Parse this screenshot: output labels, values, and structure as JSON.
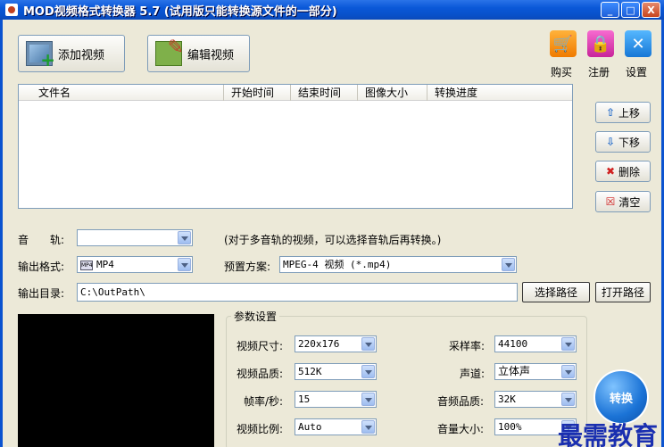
{
  "window": {
    "title": "MOD视频格式转换器 5.7 (试用版只能转换源文件的一部分)",
    "controls": {
      "minimize": "_",
      "maximize": "□",
      "close": "X"
    }
  },
  "toolbar": {
    "add_video": "添加视频",
    "edit_video": "编辑视频",
    "buy": "购买",
    "register": "注册",
    "settings": "设置"
  },
  "filelist": {
    "columns": [
      "文件名",
      "开始时间",
      "结束时间",
      "图像大小",
      "转换进度"
    ],
    "rows": []
  },
  "side_buttons": {
    "move_up": "上移",
    "move_down": "下移",
    "delete": "删除",
    "clear": "清空"
  },
  "audio_track": {
    "label": "音　　轨:",
    "value": "",
    "hint": "(对于多音轨的视频，可以选择音轨后再转换。)"
  },
  "output_format": {
    "label": "输出格式:",
    "badge": "MP4",
    "value": "MP4"
  },
  "preset": {
    "label": "预置方案:",
    "value": "MPEG-4 视频 (*.mp4)"
  },
  "output_dir": {
    "label": "输出目录:",
    "value": "C:\\OutPath\\",
    "choose_button": "选择路径",
    "open_button": "打开路径"
  },
  "params": {
    "title": "参数设置",
    "video_size_label": "视频尺寸:",
    "video_size": "220x176",
    "video_quality_label": "视频品质:",
    "video_quality": "512K",
    "framerate_label": "帧率/秒:",
    "framerate": "15",
    "aspect_label": "视频比例:",
    "aspect": "Auto",
    "samplerate_label": "采样率:",
    "samplerate": "44100",
    "channels_label": "声道:",
    "channels": "立体声",
    "audio_quality_label": "音频品质:",
    "audio_quality": "32K",
    "volume_label": "音量大小:",
    "volume": "100%"
  },
  "convert_button": "转换",
  "watermark": "最需教育"
}
